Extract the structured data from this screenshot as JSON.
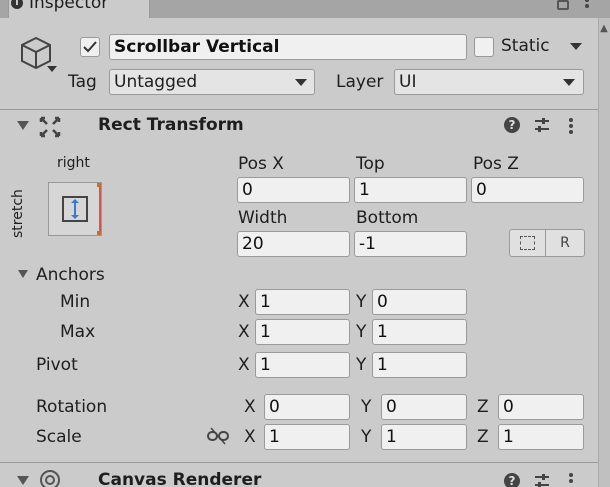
{
  "window": {
    "tab_title": "Inspector"
  },
  "header": {
    "object_name": "Scrollbar Vertical",
    "static_label": "Static",
    "tag_label": "Tag",
    "tag_value": "Untagged",
    "layer_label": "Layer",
    "layer_value": "UI"
  },
  "rect_transform": {
    "title": "Rect Transform",
    "anchor_preset_top": "right",
    "anchor_preset_side": "stretch",
    "pos_x_label": "Pos X",
    "top_label": "Top",
    "pos_z_label": "Pos Z",
    "pos_x": "0",
    "top": "1",
    "pos_z": "0",
    "width_label": "Width",
    "bottom_label": "Bottom",
    "width": "20",
    "bottom": "-1",
    "raw_button": "R",
    "anchors_label": "Anchors",
    "min_label": "Min",
    "max_label": "Max",
    "pivot_label": "Pivot",
    "x_label": "X",
    "y_label": "Y",
    "z_label": "Z",
    "min_x": "1",
    "min_y": "0",
    "max_x": "1",
    "max_y": "1",
    "pivot_x": "1",
    "pivot_y": "1",
    "rotation_label": "Rotation",
    "rot_x": "0",
    "rot_y": "0",
    "rot_z": "0",
    "scale_label": "Scale",
    "scale_x": "1",
    "scale_y": "1",
    "scale_z": "1"
  },
  "canvas_renderer": {
    "title": "Canvas Renderer"
  }
}
